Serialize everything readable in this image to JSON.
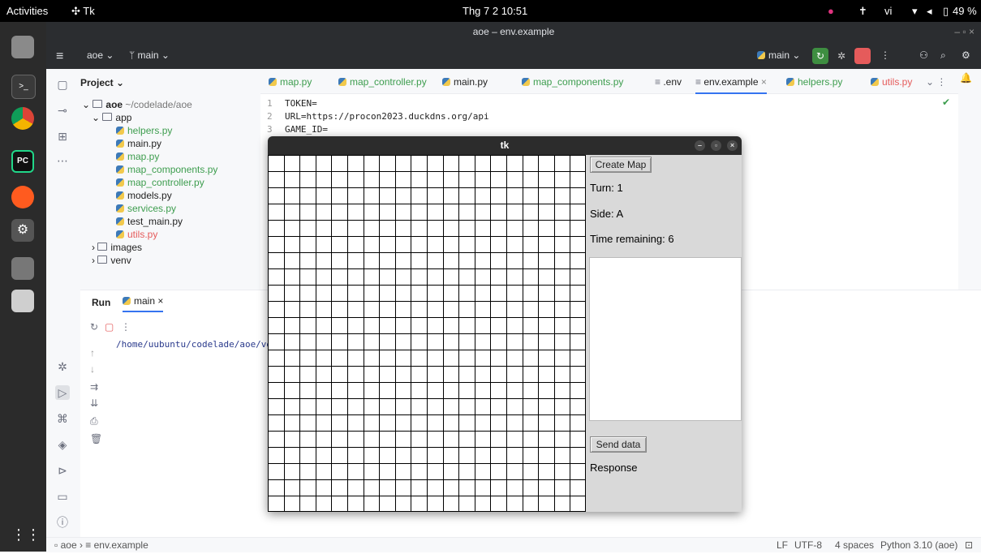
{
  "system": {
    "activities": "Activities",
    "app_name": "Tk",
    "datetime": "Thg 7 2  10:51",
    "lang": "vi",
    "battery": "49 %"
  },
  "ide": {
    "window_title": "aoe – env.example",
    "project_selector": "aoe",
    "branch_selector": "main",
    "run_config": "main",
    "project_panel_title": "Project",
    "project_root": "aoe",
    "project_root_path": "~/codelade/aoe",
    "tree": [
      {
        "label": "app",
        "kind": "folder"
      },
      {
        "label": "helpers.py",
        "kind": "file",
        "color": "#3d9d4e"
      },
      {
        "label": "main.py",
        "kind": "file",
        "color": "#222222"
      },
      {
        "label": "map.py",
        "kind": "file",
        "color": "#3d9d4e"
      },
      {
        "label": "map_components.py",
        "kind": "file",
        "color": "#3d9d4e"
      },
      {
        "label": "map_controller.py",
        "kind": "file",
        "color": "#3d9d4e"
      },
      {
        "label": "models.py",
        "kind": "file",
        "color": "#222222"
      },
      {
        "label": "services.py",
        "kind": "file",
        "color": "#3d9d4e"
      },
      {
        "label": "test_main.py",
        "kind": "file",
        "color": "#222222"
      },
      {
        "label": "utils.py",
        "kind": "file",
        "color": "#e55b5b"
      },
      {
        "label": "images",
        "kind": "folder"
      },
      {
        "label": "venv",
        "kind": "folder"
      }
    ],
    "tabs": [
      {
        "label": "map.py",
        "color": "#3d9d4e"
      },
      {
        "label": "map_controller.py",
        "color": "#3d9d4e"
      },
      {
        "label": "main.py",
        "color": "#222222"
      },
      {
        "label": "map_components.py",
        "color": "#3d9d4e"
      },
      {
        "label": ".env",
        "color": "#222222"
      },
      {
        "label": "env.example",
        "color": "#222222"
      },
      {
        "label": "helpers.py",
        "color": "#3d9d4e"
      },
      {
        "label": "utils.py",
        "color": "#e55b5b"
      }
    ],
    "code_lines": [
      {
        "num": "1",
        "text": "TOKEN="
      },
      {
        "num": "2",
        "text": "URL=https://procon2023.duckdns.org/api"
      },
      {
        "num": "3",
        "text": "GAME_ID="
      }
    ],
    "run_tab": "Run",
    "run_session": "main",
    "console_output": "/home/uubuntu/codelade/aoe/venv/b",
    "breadcrumb_root": "aoe",
    "breadcrumb_file": "env.example",
    "status_items": [
      "LF",
      "UTF-8",
      "4 spaces",
      "Python 3.10 (aoe)"
    ]
  },
  "tk": {
    "title": "tk",
    "create_map": "Create Map",
    "turn": "Turn: 1",
    "side": "Side: A",
    "time_remaining": "Time remaining: 6",
    "send_data": "Send data",
    "response": "Response",
    "grid_cols": 20,
    "grid_rows": 22
  }
}
